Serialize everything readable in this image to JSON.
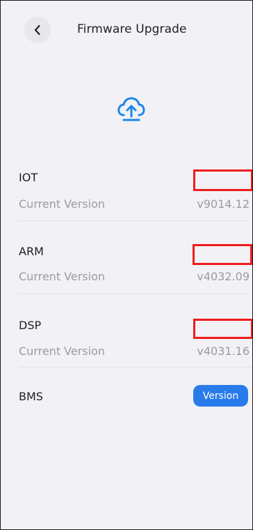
{
  "header": {
    "title": "Firmware Upgrade",
    "back_icon": "chevron-left-icon"
  },
  "hero": {
    "icon": "cloud-upload-icon",
    "accent_color": "#1d86ea"
  },
  "rows": [
    {
      "name": "IOT",
      "subtitle": "Current Version",
      "version": "v9014.12"
    },
    {
      "name": "ARM",
      "subtitle": "Current Version",
      "version": "v4032.09"
    },
    {
      "name": "DSP",
      "subtitle": "Current Version",
      "version": "v4031.16"
    }
  ],
  "bms": {
    "name": "BMS",
    "button_label": "Version"
  }
}
